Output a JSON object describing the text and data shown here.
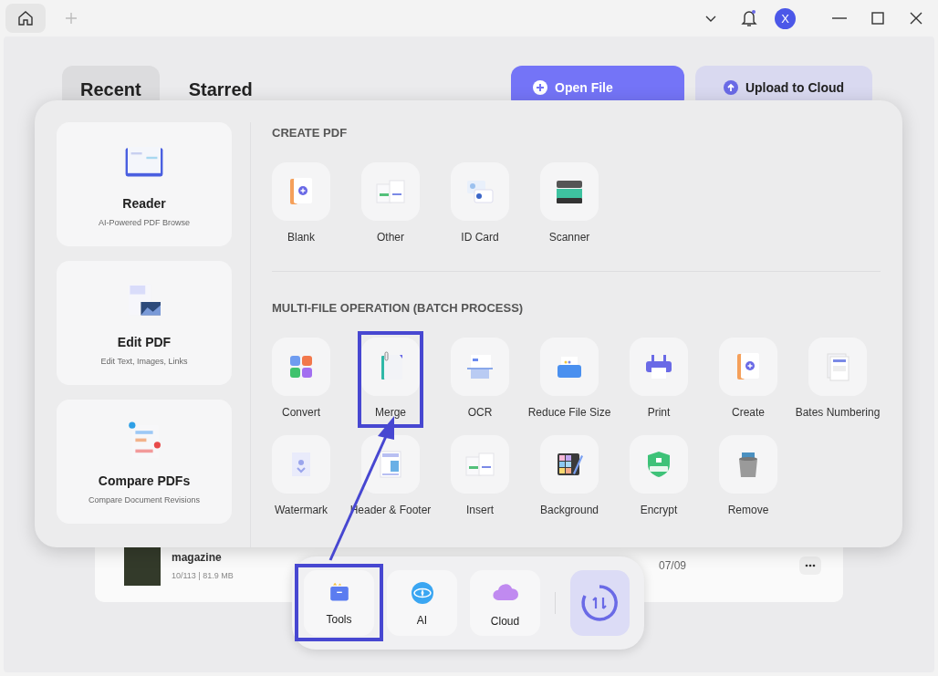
{
  "top_bar": {
    "avatar": "X"
  },
  "tabs": [
    {
      "label": "Recent",
      "selected": true
    },
    {
      "label": "Starred",
      "selected": false
    }
  ],
  "actions": [
    {
      "label": "Open File",
      "kind": "primary"
    },
    {
      "label": "Upload to Cloud",
      "kind": "secondary"
    }
  ],
  "files": [
    {
      "name": "magazine",
      "meta": "10/113 | 81.9 MB",
      "date": "07/09"
    }
  ],
  "tools_panel": {
    "modes": [
      {
        "title": "Reader",
        "subtitle": "AI-Powered PDF Browse"
      },
      {
        "title": "Edit PDF",
        "subtitle": "Edit Text, Images, Links"
      },
      {
        "title": "Compare PDFs",
        "subtitle": "Compare Document Revisions"
      }
    ],
    "sections": [
      {
        "title": "CREATE PDF",
        "items": [
          {
            "label": "Blank",
            "highlighted": false
          },
          {
            "label": "Other",
            "highlighted": false
          },
          {
            "label": "ID Card",
            "highlighted": false
          },
          {
            "label": "Scanner",
            "highlighted": false
          }
        ]
      },
      {
        "title": "MULTI-FILE OPERATION (BATCH PROCESS)",
        "items": [
          {
            "label": "Convert",
            "highlighted": false
          },
          {
            "label": "Merge",
            "highlighted": true
          },
          {
            "label": "OCR",
            "highlighted": false
          },
          {
            "label": "Reduce File Size",
            "highlighted": false
          },
          {
            "label": "Print",
            "highlighted": false
          },
          {
            "label": "Create",
            "highlighted": false
          },
          {
            "label": "Bates Numbering",
            "highlighted": false
          },
          {
            "label": "Watermark",
            "highlighted": false
          },
          {
            "label": "Header & Footer",
            "highlighted": false
          },
          {
            "label": "Insert",
            "highlighted": false
          },
          {
            "label": "Background",
            "highlighted": false
          },
          {
            "label": "Encrypt",
            "highlighted": false
          },
          {
            "label": "Remove",
            "highlighted": false
          }
        ]
      }
    ]
  },
  "dock": {
    "items": [
      {
        "label": "Tools",
        "highlighted": true
      },
      {
        "label": "AI",
        "highlighted": false
      },
      {
        "label": "Cloud",
        "highlighted": false
      }
    ]
  }
}
